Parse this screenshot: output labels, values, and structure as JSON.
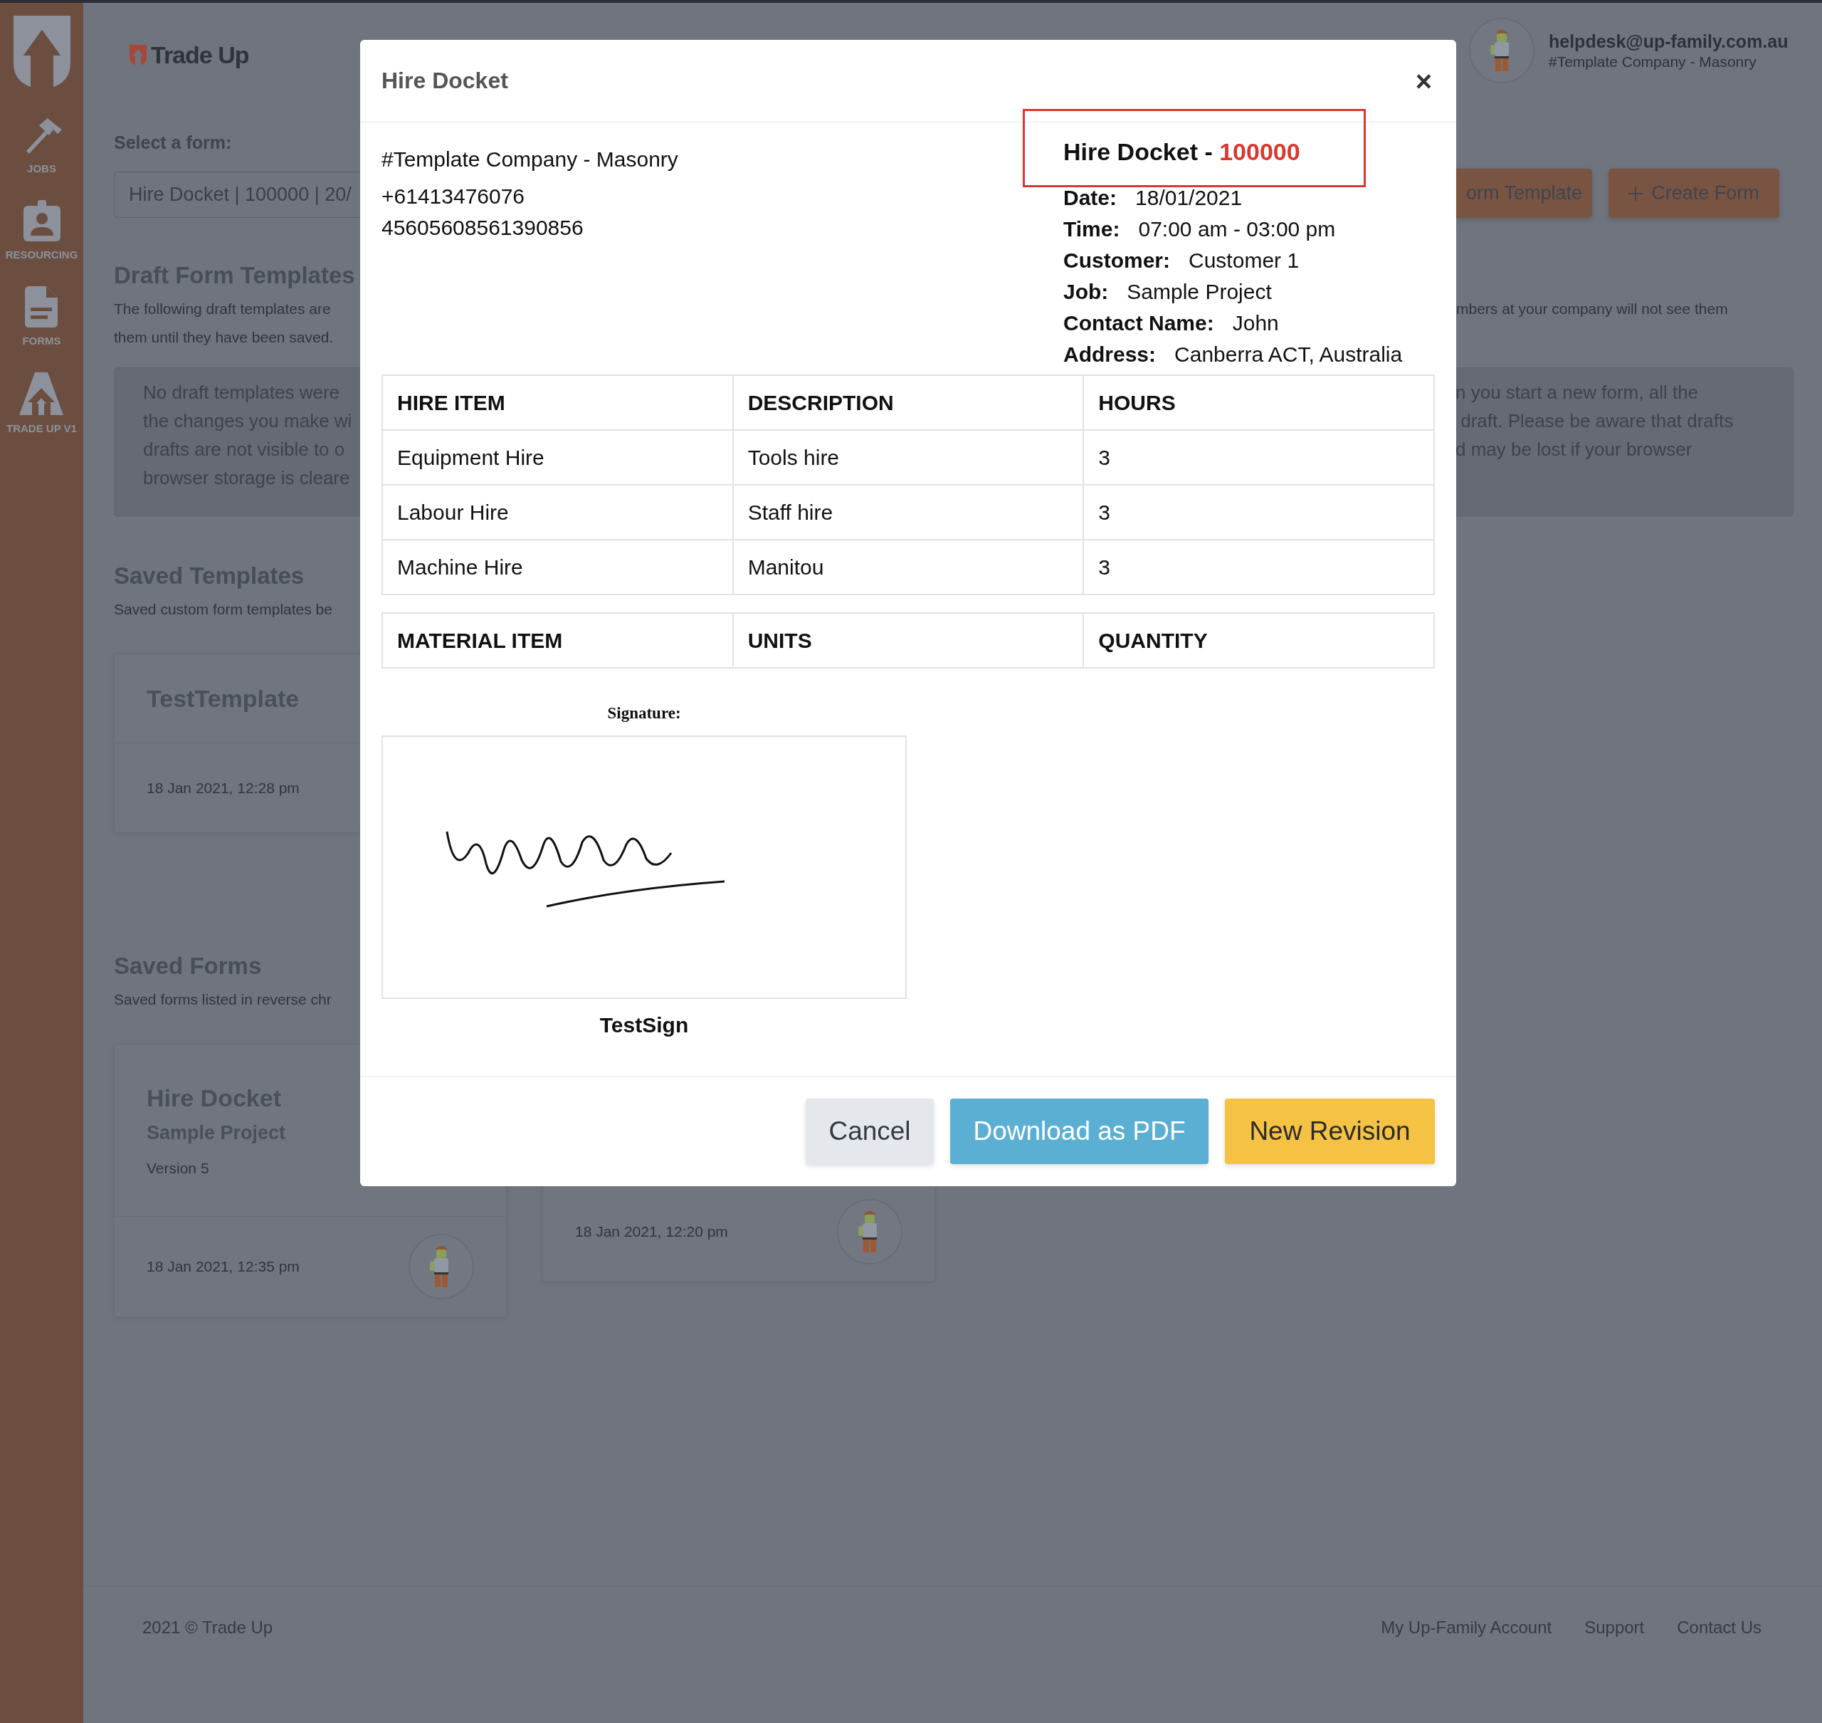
{
  "sidebar": {
    "items": [
      {
        "kind": "hammer",
        "label": "JOBS"
      },
      {
        "kind": "badge",
        "label": "RESOURCING"
      },
      {
        "kind": "file",
        "label": "FORMS"
      },
      {
        "kind": "letter",
        "label": "TRADE UP V1"
      }
    ]
  },
  "header": {
    "logo": "Trade Up",
    "user": {
      "email": "helpdesk@up-family.com.au",
      "company": "#Template Company - Masonry"
    }
  },
  "form_select": {
    "label": "Select a form:",
    "value": "Hire Docket | 100000 | 20/"
  },
  "actions": [
    {
      "kind": "plain",
      "label": "orm Template"
    },
    {
      "kind": "plus",
      "label": "Create Form"
    }
  ],
  "draft_templates": {
    "title": "Draft Form Templates",
    "description_left": "The following draft templates are\nthem until they have been saved.",
    "description_right": "mbers at your company will not see them",
    "notice_left": "No draft templates were\nthe changes you make wi\ndrafts are not visible to o\nbrowser storage is cleare",
    "notice_right": "n you start a new form, all the\n draft. Please be aware that drafts\nd may be lost if your browser"
  },
  "saved_templates": {
    "title": "Saved Templates",
    "description": "Saved custom form templates be",
    "cards": [
      {
        "title": "TestTemplate",
        "date": "18 Jan 2021, 12:28 pm"
      }
    ]
  },
  "saved_forms": {
    "title": "Saved Forms",
    "description": "Saved forms listed in reverse chr",
    "cards": [
      {
        "title": "Hire Docket",
        "subtitle": "Sample Project",
        "version": "Version 5",
        "date": "18 Jan 2021, 12:35 pm"
      },
      {
        "date": "18 Jan 2021, 12:20 pm"
      }
    ]
  },
  "footer": {
    "copyright": "2021 © Trade Up",
    "links": [
      "My Up-Family Account",
      "Support",
      "Contact Us"
    ]
  },
  "modal": {
    "title": "Hire Docket",
    "close": "×",
    "company": [
      "#Template Company - Masonry",
      "+61413476076",
      "45605608561390856"
    ],
    "docket": {
      "label": "Hire Docket -",
      "number": "100000"
    },
    "fields": [
      {
        "label": "Date:",
        "value": "18/01/2021"
      },
      {
        "label": "Time:",
        "value": "07:00 am - 03:00 pm"
      },
      {
        "label": "Customer:",
        "value": "Customer 1"
      },
      {
        "label": "Job:",
        "value": "Sample Project"
      },
      {
        "label": "Contact Name:",
        "value": "John"
      },
      {
        "label": "Address:",
        "value": "Canberra ACT, Australia"
      }
    ],
    "hire_table": {
      "columns": [
        "HIRE ITEM",
        "DESCRIPTION",
        "HOURS"
      ],
      "rows": [
        [
          "Equipment Hire",
          "Tools hire",
          "3"
        ],
        [
          "Labour Hire",
          "Staff hire",
          "3"
        ],
        [
          "Machine Hire",
          "Manitou",
          "3"
        ]
      ]
    },
    "material_table": {
      "columns": [
        "MATERIAL ITEM",
        "UNITS",
        "QUANTITY"
      ]
    },
    "signature": {
      "label": "Signature:",
      "name": "TestSign"
    },
    "buttons": [
      {
        "kind": "cancel",
        "label": "Cancel"
      },
      {
        "kind": "download",
        "label": "Download as PDF"
      },
      {
        "kind": "revision",
        "label": "New Revision"
      }
    ]
  }
}
